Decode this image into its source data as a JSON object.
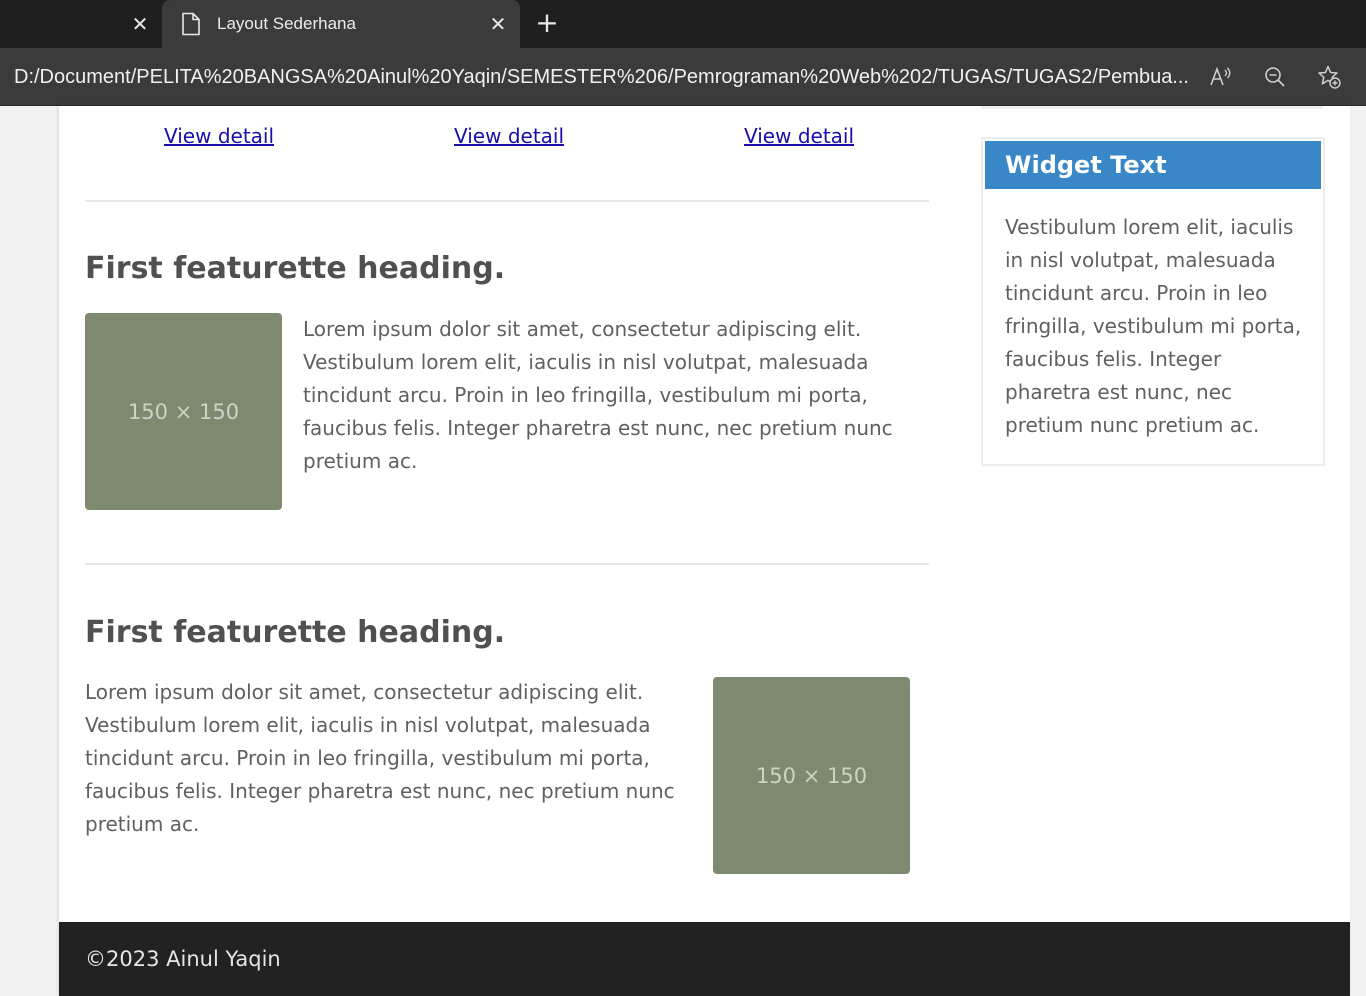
{
  "browser": {
    "tab_title": "Layout Sederhana",
    "address": "D:/Document/PELITA%20BANGSA%20Ainul%20Yaqin/SEMESTER%206/Pemrograman%20Web%202/TUGAS/TUGAS2/Pembua..."
  },
  "links": {
    "detail_1": "View detail",
    "detail_2": "View detail",
    "detail_3": "View detail"
  },
  "featurettes": [
    {
      "heading": "First featurette heading.",
      "text": "Lorem ipsum dolor sit amet, consectetur adipiscing elit. Vestibulum lorem elit, iaculis in nisl volutpat, malesuada tincidunt arcu. Proin in leo fringilla, vestibulum mi porta, faucibus felis. Integer pharetra est nunc, nec pretium nunc pretium ac.",
      "image_label": "150 × 150"
    },
    {
      "heading": "First featurette heading.",
      "text": "Lorem ipsum dolor sit amet, consectetur adipiscing elit. Vestibulum lorem elit, iaculis in nisl volutpat, malesuada tincidunt arcu. Proin in leo fringilla, vestibulum mi porta, faucibus felis. Integer pharetra est nunc, nec pretium nunc pretium ac.",
      "image_label": "150 × 150"
    }
  ],
  "widget": {
    "title": "Widget Text",
    "body": "Vestibulum lorem elit, iaculis in nisl volutpat, malesuada tincidunt arcu. Proin in leo fringilla, vestibulum mi porta, faucibus felis. Integer pharetra est nunc, nec pretium nunc pretium ac."
  },
  "footer": {
    "text": "©2023 Ainul Yaqin"
  },
  "colors": {
    "widget_header": "#3a87c8",
    "placeholder": "#7e8a70",
    "footer_bg": "#222222",
    "link": "#1a0dab"
  }
}
